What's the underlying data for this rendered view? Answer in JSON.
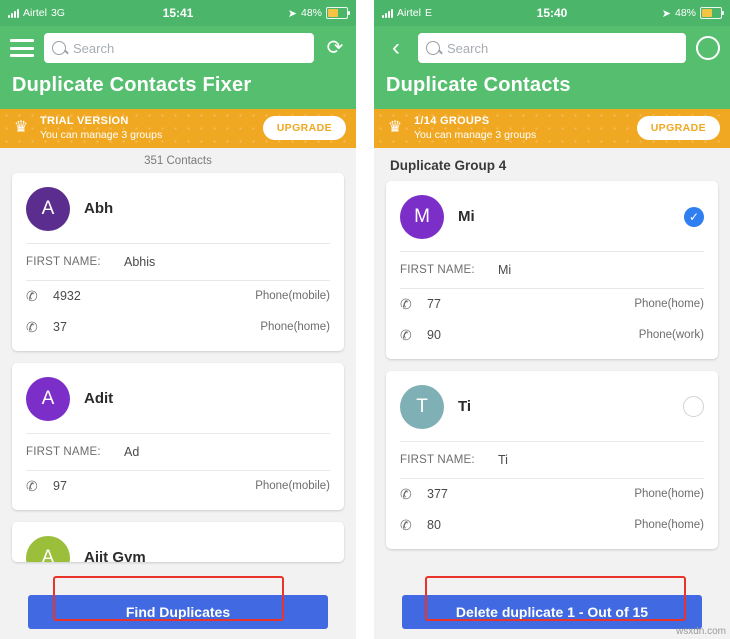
{
  "left": {
    "status": {
      "carrier": "Airtel",
      "network": "3G",
      "time": "15:41",
      "battery": "48%"
    },
    "header": {
      "search_placeholder": "Search",
      "title": "Duplicate Contacts Fixer",
      "menu_icon": "hamburger-icon",
      "refresh_icon": "refresh-icon"
    },
    "banner": {
      "line1": "TRIAL VERSION",
      "line2": "You can manage 3 groups",
      "button": "UPGRADE",
      "icon": "crown-icon"
    },
    "subheader": "351 Contacts",
    "cards": [
      {
        "initial": "A",
        "avatar_color": "#5b2d8e",
        "name": "Abh",
        "field_label": "FIRST NAME:",
        "field_value": "Abhis",
        "phones": [
          {
            "number": "4932",
            "type": "Phone(mobile)"
          },
          {
            "number": "37",
            "type": "Phone(home)"
          }
        ]
      },
      {
        "initial": "A",
        "avatar_color": "#7b2ec8",
        "name": "Adit",
        "field_label": "FIRST NAME:",
        "field_value": "Ad",
        "phones": [
          {
            "number": "97",
            "type": "Phone(mobile)"
          }
        ]
      },
      {
        "initial": "A",
        "avatar_color": "#9bbf3a",
        "name": "Ajit Gym",
        "field_label": "",
        "field_value": "",
        "phones": []
      }
    ],
    "bottom_button": "Find Duplicates"
  },
  "right": {
    "status": {
      "carrier": "Airtel",
      "network": "E",
      "time": "15:40",
      "battery": "48%"
    },
    "header": {
      "search_placeholder": "Search",
      "title": "Duplicate Contacts",
      "back_icon": "back-arrow-icon",
      "right_icon": "circle-icon"
    },
    "banner": {
      "line1": "1/14 GROUPS",
      "line2": "You can manage 3 groups",
      "button": "UPGRADE",
      "icon": "crown-icon"
    },
    "group_title": "Duplicate Group 4",
    "cards": [
      {
        "initial": "M",
        "avatar_color": "#7b2ec8",
        "name": "Mi",
        "selected": true,
        "check_glyph": "✓",
        "field_label": "FIRST NAME:",
        "field_value": "Mi",
        "phones": [
          {
            "number": "77",
            "type": "Phone(home)"
          },
          {
            "number": "90",
            "type": "Phone(work)"
          }
        ]
      },
      {
        "initial": "T",
        "avatar_color": "#7fb0b5",
        "name": "Ti",
        "selected": false,
        "check_glyph": "",
        "field_label": "FIRST NAME:",
        "field_value": "Ti",
        "phones": [
          {
            "number": "377",
            "type": "Phone(home)"
          },
          {
            "number": "80",
            "type": "Phone(home)"
          }
        ]
      }
    ],
    "bottom_button": "Delete duplicate 1 - Out of 15"
  },
  "watermark": "wsxdn.com",
  "colors": {
    "green": "#56bf6f",
    "orange": "#f0a823",
    "blue": "#4169e1",
    "red": "#e8342a"
  }
}
